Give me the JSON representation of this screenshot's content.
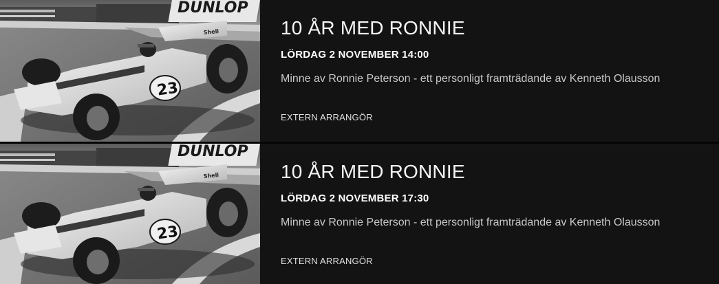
{
  "events": [
    {
      "title": "10 ÅR MED RONNIE",
      "date": "LÖRDAG 2 NOVEMBER 14:00",
      "description": "Minne av Ronnie Peterson - ett personligt framträdande av Kenneth Olausson",
      "organizer": "EXTERN ARRANGÖR",
      "image": {
        "subject": "race-car-photo",
        "car_number": "23",
        "sponsor_text": "DUNLOP",
        "sponsor_text_2": "Shell"
      }
    },
    {
      "title": "10 ÅR MED RONNIE",
      "date": "LÖRDAG 2 NOVEMBER 17:30",
      "description": "Minne av Ronnie Peterson - ett personligt framträdande av Kenneth Olausson",
      "organizer": "EXTERN ARRANGÖR",
      "image": {
        "subject": "race-car-photo",
        "car_number": "23",
        "sponsor_text": "DUNLOP",
        "sponsor_text_2": "Shell"
      }
    }
  ],
  "colors": {
    "background": "#131313",
    "separator": "#050505",
    "title": "#f5f5f5",
    "description": "#c8c8c8"
  }
}
